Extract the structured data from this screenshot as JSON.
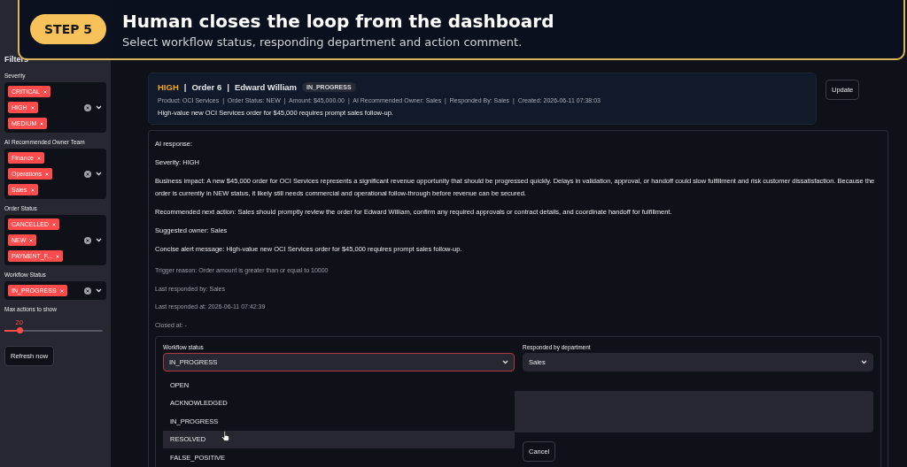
{
  "banner": {
    "step": "STEP 5",
    "title": "Human closes the loop from the dashboard",
    "subtitle": "Select workflow status, responding department and action comment."
  },
  "sidebar": {
    "title": "Filters",
    "filters": [
      {
        "label": "Severity",
        "tags": [
          "CRITICAL",
          "HIGH",
          "MEDIUM"
        ]
      },
      {
        "label": "AI Recommended Owner Team",
        "tags": [
          "Finance",
          "Operations",
          "Sales"
        ]
      },
      {
        "label": "Order Status",
        "tags": [
          "CANCELLED",
          "NEW",
          "PAYMENT_F..."
        ]
      },
      {
        "label": "Workflow Status",
        "tags": [
          "IN_PROGRESS"
        ]
      }
    ],
    "slider": {
      "label": "Max actions to show",
      "reading": "20",
      "level": 0.15
    },
    "refresh_button": "Refresh now"
  },
  "action": {
    "severity": "HIGH",
    "separator": "|",
    "order": "Order 6",
    "customer": "Edward William",
    "status_badge": "IN_PROGRESS",
    "meta": "Product: OCI Services  |  Order Status: NEW  |  Amount: $45,000.00  |  AI Recommended Owner: Sales  |  Responded By: Sales  |  Created: 2026-06-11 07:38:03",
    "summary": "High-value new OCI Services order for $45,000 requires prompt sales follow-up.",
    "update_button": "Update"
  },
  "response": {
    "lines": [
      {
        "kind": "main",
        "text": "AI response:"
      },
      {
        "kind": "main",
        "text": "Severity: HIGH"
      },
      {
        "kind": "main",
        "text": "Business impact: A new $45,000 order for OCI Services represents a significant revenue opportunity that should be progressed quickly. Delays in validation, approval, or handoff could slow fulfillment and risk customer dissatisfaction. Because the order is currently in NEW status, it likely still needs commercial and operational follow-through before revenue can be secured."
      },
      {
        "kind": "main",
        "text": "Recommended next action: Sales should promptly review the order for Edward William, confirm any required approvals or contract details, and coordinate handoff for fulfillment."
      },
      {
        "kind": "main",
        "text": "Suggested owner: Sales"
      },
      {
        "kind": "main",
        "text": "Concise alert message: High-value new OCI Services order for $45,000 requires prompt sales follow-up."
      },
      {
        "kind": "minor",
        "text": "Trigger reason: Order amount is greater than or equal to 10000"
      },
      {
        "kind": "minor",
        "text": "Last responded by: Sales"
      },
      {
        "kind": "minor",
        "text": "Last responded at: 2026-06-11 07:42:39"
      },
      {
        "kind": "minor",
        "text": "Closed at: -"
      }
    ]
  },
  "form": {
    "workflow_status": {
      "label": "Workflow status",
      "value": "IN_PROGRESS",
      "expanded": true,
      "options": [
        {
          "label": "OPEN",
          "hovered": false
        },
        {
          "label": "ACKNOWLEDGED",
          "hovered": false
        },
        {
          "label": "IN_PROGRESS",
          "hovered": false
        },
        {
          "label": "RESOLVED",
          "hovered": true
        },
        {
          "label": "FALSE_POSITIVE",
          "hovered": false
        }
      ]
    },
    "department": {
      "label": "Responded by department",
      "value": "Sales"
    },
    "cancel_button": "Cancel"
  }
}
